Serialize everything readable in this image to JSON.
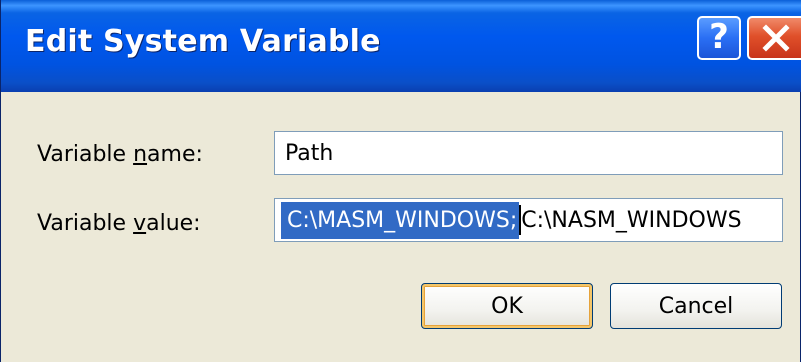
{
  "window": {
    "title": "Edit System Variable",
    "help_glyph": "?",
    "close_icon": "close-icon"
  },
  "form": {
    "name_label_pre": "Variable ",
    "name_label_mnemonic": "n",
    "name_label_post": "ame:",
    "name_value": "Path",
    "value_label_pre": "Variable ",
    "value_label_mnemonic": "v",
    "value_label_post": "alue:",
    "value_selected": "C:\\MASM_WINDOWS;",
    "value_rest": "C:\\NASM_WINDOWS"
  },
  "buttons": {
    "ok_label": "OK",
    "cancel_label": "Cancel"
  },
  "colors": {
    "title_bar": "#0058ee",
    "close_button": "#e0502a",
    "selection": "#316ac5",
    "dialog_face": "#ece9d8"
  }
}
